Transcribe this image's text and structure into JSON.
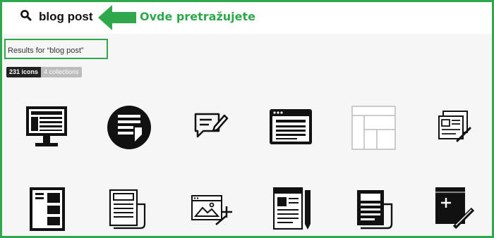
{
  "search": {
    "value": "blog post"
  },
  "annotation": {
    "text": "Ovde pretražujete",
    "color": "#2ea84a"
  },
  "results": {
    "label": "Results for “blog post”"
  },
  "tabs": [
    {
      "label": "231 icons",
      "active": true
    },
    {
      "label": "4 collections",
      "active": false
    }
  ],
  "icons": [
    "desktop-monitor-icon",
    "newspaper-circle-icon",
    "chat-edit-icon",
    "browser-window-icon",
    "layout-wireframe-icon",
    "newsletter-pages-icon",
    "mobile-layout-icon",
    "newspaper-icon",
    "web-image-add-icon",
    "document-pen-icon",
    "newspaper-solid-icon",
    "add-post-pencil-icon"
  ]
}
